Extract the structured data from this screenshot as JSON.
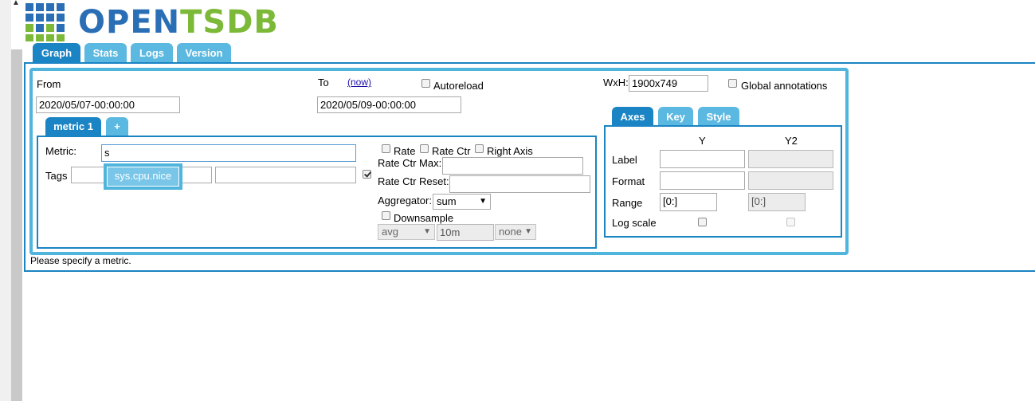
{
  "app": {
    "logo_text_1": "OPEN",
    "logo_text_2": "TSDB",
    "colors": {
      "accent": "#1a84c4",
      "tab_inactive": "#5bb8e0",
      "logo_blue": "#2a6fb5",
      "logo_green": "#7cb938"
    }
  },
  "main_tabs": [
    {
      "label": "Graph",
      "active": true
    },
    {
      "label": "Stats",
      "active": false
    },
    {
      "label": "Logs",
      "active": false
    },
    {
      "label": "Version",
      "active": false
    }
  ],
  "time": {
    "from_label": "From",
    "from_value": "2020/05/07-00:00:00",
    "to_label": "To",
    "now_link": "(now)",
    "to_value": "2020/05/09-00:00:00",
    "autoreload_label": "Autoreload"
  },
  "size": {
    "label": "WxH:",
    "value": "1900x749",
    "global_annotations_label": "Global annotations"
  },
  "metric_tabs": [
    {
      "label": "metric 1",
      "active": true
    },
    {
      "label": "+",
      "active": false
    }
  ],
  "metric": {
    "metric_label": "Metric:",
    "metric_value": "s",
    "tags_label": "Tags",
    "autocomplete_suggestion": "sys.cpu.nice",
    "rate_label": "Rate",
    "rate_ctr_label": "Rate Ctr",
    "right_axis_label": "Right Axis",
    "rate_ctr_max_label": "Rate Ctr Max:",
    "rate_ctr_reset_label": "Rate Ctr Reset:",
    "aggregator_label": "Aggregator:",
    "aggregator_value": "sum",
    "downsample_label": "Downsample",
    "downsample_func": "avg",
    "downsample_interval": "10m",
    "downsample_fill": "none"
  },
  "axes_tabs": [
    {
      "label": "Axes",
      "active": true
    },
    {
      "label": "Key",
      "active": false
    },
    {
      "label": "Style",
      "active": false
    }
  ],
  "axes": {
    "col_y": "Y",
    "col_y2": "Y2",
    "label_row": "Label",
    "format_row": "Format",
    "range_row": "Range",
    "range_y": "[0:]",
    "range_y2": "[0:]",
    "log_scale_row": "Log scale"
  },
  "status_message": "Please specify a metric."
}
